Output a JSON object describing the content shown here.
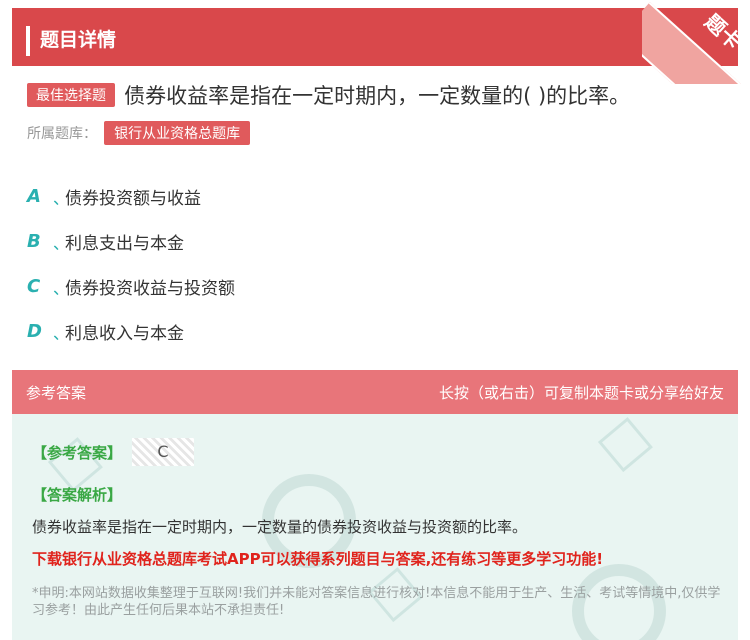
{
  "header": {
    "title": "题目详情",
    "corner_label": "题卡"
  },
  "question": {
    "tag": "最佳选择题",
    "text": "债券收益率是指在一定时期内，一定数量的( )的比率。",
    "bank_label": "所属题库：",
    "bank_name": "银行从业资格总题库"
  },
  "options": [
    {
      "letter": "A",
      "sep": "、",
      "text": "债券投资额与收益"
    },
    {
      "letter": "B",
      "sep": "、",
      "text": "利息支出与本金"
    },
    {
      "letter": "C",
      "sep": "、",
      "text": "债券投资收益与投资额"
    },
    {
      "letter": "D",
      "sep": "、",
      "text": "利息收入与本金"
    }
  ],
  "answer": {
    "section_title": "参考答案",
    "hint": "长按（或右击）可复制本题卡或分享给好友",
    "ref_label": "【参考答案】",
    "ref_value": "C",
    "analysis_label": "【答案解析】",
    "analysis_text": "债券收益率是指在一定时期内，一定数量的债券投资收益与投资额的比率。",
    "promo": "下载银行从业资格总题库考试APP可以获得系列题目与答案,还有练习等更多学习功能!",
    "disclaimer": "*申明:本网站数据收集整理于互联网!我们并未能对答案信息进行核对!本信息不能用于生产、生活、考试等情境中,仅供学习参考！由此产生任何后果本站不承担责任!"
  },
  "colors": {
    "primary": "#d9484b",
    "accent": "#2ab0b0",
    "answer_bg": "#e9f5f2",
    "green": "#3aa845",
    "promo": "#e0231c"
  }
}
